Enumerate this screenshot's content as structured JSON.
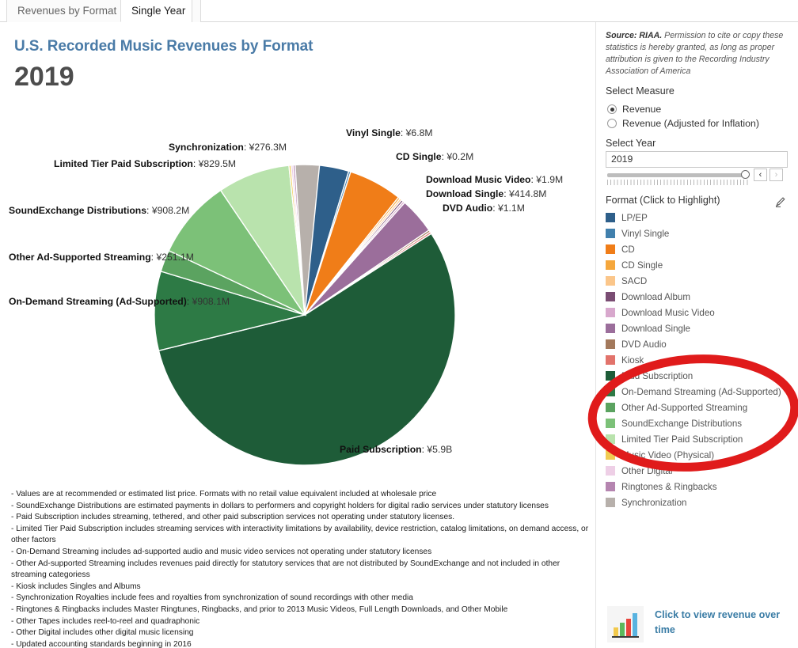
{
  "tabs": [
    {
      "label": "Revenues by Format",
      "active": false
    },
    {
      "label": "Single Year",
      "active": true
    }
  ],
  "header": {
    "title": "U.S. Recorded Music Revenues by Format",
    "year": "2019"
  },
  "source": {
    "prefix": "Source: RIAA.",
    "text": " Permission to cite or copy these statistics is hereby granted, as long as proper attribution is given to the Recording Industry Association of America"
  },
  "controls": {
    "measure_label": "Select Measure",
    "measure_options": [
      {
        "label": "Revenue",
        "selected": true
      },
      {
        "label": "Revenue (Adjusted for Inflation)",
        "selected": false
      }
    ],
    "year_label": "Select Year",
    "year_value": "2019",
    "prev_arrow": "‹",
    "next_arrow": "›",
    "format_label": "Format (Click to Highlight)",
    "highlight_icon": "pencil-highlighter-icon"
  },
  "legend": [
    {
      "label": "LP/EP",
      "color": "#2e5f8a"
    },
    {
      "label": "Vinyl Single",
      "color": "#4180ad"
    },
    {
      "label": "CD",
      "color": "#f07d18"
    },
    {
      "label": "CD Single",
      "color": "#f5a73c"
    },
    {
      "label": "SACD",
      "color": "#fbc68a"
    },
    {
      "label": "Download Album",
      "color": "#7a4d73"
    },
    {
      "label": "Download Music Video",
      "color": "#d8a8cd"
    },
    {
      "label": "Download Single",
      "color": "#9b6e9b"
    },
    {
      "label": "DVD Audio",
      "color": "#a3795c"
    },
    {
      "label": "Kiosk",
      "color": "#e2736b"
    },
    {
      "label": "Paid Subscription",
      "color": "#1e5c38"
    },
    {
      "label": "On-Demand Streaming (Ad-Supported)",
      "color": "#2d7a45"
    },
    {
      "label": "Other Ad-Supported Streaming",
      "color": "#5ba360"
    },
    {
      "label": "SoundExchange Distributions",
      "color": "#7cc178"
    },
    {
      "label": "Limited Tier Paid Subscription",
      "color": "#b9e3ad"
    },
    {
      "label": "Music Video (Physical)",
      "color": "#f0cb52"
    },
    {
      "label": "Other Digital",
      "color": "#eecfe6"
    },
    {
      "label": "Ringtones & Ringbacks",
      "color": "#b585b0"
    },
    {
      "label": "Synchronization",
      "color": "#b7b0ab"
    }
  ],
  "chart_data": {
    "type": "pie",
    "title": "U.S. Recorded Music Revenues by Format",
    "subtitle": "2019",
    "units": "¥",
    "start_angle_deg": 0,
    "direction": "clockwise",
    "legend_position": "right",
    "labels_shown": [
      "LP/EP",
      "Vinyl Single",
      "CD",
      "CD Single",
      "Download Music Video",
      "Download Single",
      "DVD Audio",
      "Paid Subscription",
      "On-Demand Streaming (Ad-Supported)",
      "Other Ad-Supported Streaming",
      "SoundExchange Distributions",
      "Limited Tier Paid Subscription",
      "Synchronization"
    ],
    "slices": [
      {
        "name": "LP/EP",
        "value": 504.0,
        "display": "¥504.0M",
        "color": "#2e5f8a"
      },
      {
        "name": "Vinyl Single",
        "value": 6.8,
        "display": "¥6.8M",
        "color": "#4180ad"
      },
      {
        "name": "CD",
        "value": 614.5,
        "display": "¥614.5M",
        "color": "#f07d18"
      },
      {
        "name": "CD Single",
        "value": 0.2,
        "display": "¥0.2M",
        "color": "#f5a73c"
      },
      {
        "name": "SACD",
        "value": 0.0,
        "display": "¥0.0M",
        "color": "#fbc68a"
      },
      {
        "name": "Download Album",
        "value": 0.0,
        "display": "¥0.0M",
        "color": "#7a4d73"
      },
      {
        "name": "Download Music Video",
        "value": 1.9,
        "display": "¥1.9M",
        "color": "#d8a8cd"
      },
      {
        "name": "Download Single",
        "value": 414.8,
        "display": "¥414.8M",
        "color": "#9b6e9b"
      },
      {
        "name": "DVD Audio",
        "value": 1.1,
        "display": "¥1.1M",
        "color": "#a3795c"
      },
      {
        "name": "Kiosk",
        "value": 0.0,
        "display": "¥0.0M",
        "color": "#e2736b"
      },
      {
        "name": "Paid Subscription",
        "value": 5900.0,
        "display": "¥5.9B",
        "color": "#1e5c38"
      },
      {
        "name": "On-Demand Streaming (Ad-Supported)",
        "value": 908.1,
        "display": "¥908.1M",
        "color": "#2d7a45"
      },
      {
        "name": "Other Ad-Supported Streaming",
        "value": 251.1,
        "display": "¥251.1M",
        "color": "#5ba360"
      },
      {
        "name": "SoundExchange Distributions",
        "value": 908.2,
        "display": "¥908.2M",
        "color": "#7cc178"
      },
      {
        "name": "Limited Tier Paid Subscription",
        "value": 829.5,
        "display": "¥829.5M",
        "color": "#b9e3ad"
      },
      {
        "name": "Music Video (Physical)",
        "value": 19.0,
        "display": "¥19.0M",
        "color": "#f0cb52"
      },
      {
        "name": "Other Digital",
        "value": 17.0,
        "display": "¥17.0M",
        "color": "#eecfe6"
      },
      {
        "name": "Ringtones & Ringbacks",
        "value": 22.0,
        "display": "¥22.0M",
        "color": "#b585b0"
      },
      {
        "name": "Synchronization",
        "value": 276.3,
        "display": "¥276.3M",
        "color": "#b7b0ab"
      }
    ]
  },
  "pie_labels": [
    {
      "name": "Synchronization",
      "value": "¥276.3M"
    },
    {
      "name": "Limited Tier Paid Subscription",
      "value": "¥829.5M"
    },
    {
      "name": "SoundExchange Distributions",
      "value": "¥908.2M"
    },
    {
      "name": "Other Ad-Supported Streaming",
      "value": "¥251.1M"
    },
    {
      "name": "On-Demand Streaming (Ad-Supported)",
      "value": "¥908.1M"
    },
    {
      "name": "Paid Subscription",
      "value": "¥5.9B"
    },
    {
      "name": "Vinyl Single",
      "value": "¥6.8M"
    },
    {
      "name": "CD Single",
      "value": "¥0.2M"
    },
    {
      "name": "Download Music Video",
      "value": "¥1.9M"
    },
    {
      "name": "Download Single",
      "value": "¥414.8M"
    },
    {
      "name": "DVD Audio",
      "value": "¥1.1M"
    }
  ],
  "notes": [
    "- Values are at recommended or estimated list price. Formats with no retail value equivalent included at wholesale price",
    "- SoundExchange Distributions are estimated payments in dollars to performers and copyright holders for digital radio services under statutory licenses",
    "- Paid Subscription includes streaming, tethered, and other paid subscription services not operating under statutory licenses.",
    "- Limited Tier Paid Subscription includes streaming services with interactivity limitations by availability, device restriction, catalog limitations, on demand access, or other factors",
    "- On-Demand Streaming includes ad-supported audio and music video services not operating under statutory licenses",
    "- Other Ad-supported Streaming includes revenues paid directly for statutory services that are not distributed by SoundExchange and not included in other streaming categoriess",
    "- Kiosk includes Singles and Albums",
    "- Synchronization Royalties include fees and royalties from synchronization of sound recordings with other media",
    "- Ringtones & Ringbacks includes Master Ringtunes, Ringbacks, and prior to 2013 Music Videos, Full Length Downloads, and Other Mobile",
    "- Other Tapes includes reel-to-reel and quadraphonic",
    "- Other Digital includes other digital music licensing",
    "- Updated accounting standards beginning in 2016"
  ],
  "footer": {
    "link_text": "Click to view revenue over time",
    "icon": "bar-chart-icon"
  },
  "annotation": {
    "shape": "ellipse",
    "color": "#e01b1b",
    "targets": [
      "Paid Subscription",
      "On-Demand Streaming (Ad-Supported)",
      "Other Ad-Supported Streaming",
      "SoundExchange Distributions",
      "Limited Tier Paid Subscription",
      "Music Video (Physical)"
    ]
  },
  "colors": {
    "accent_title": "#4a7ba7",
    "link": "#3a7ca5",
    "annotation_red": "#e01b1b"
  }
}
